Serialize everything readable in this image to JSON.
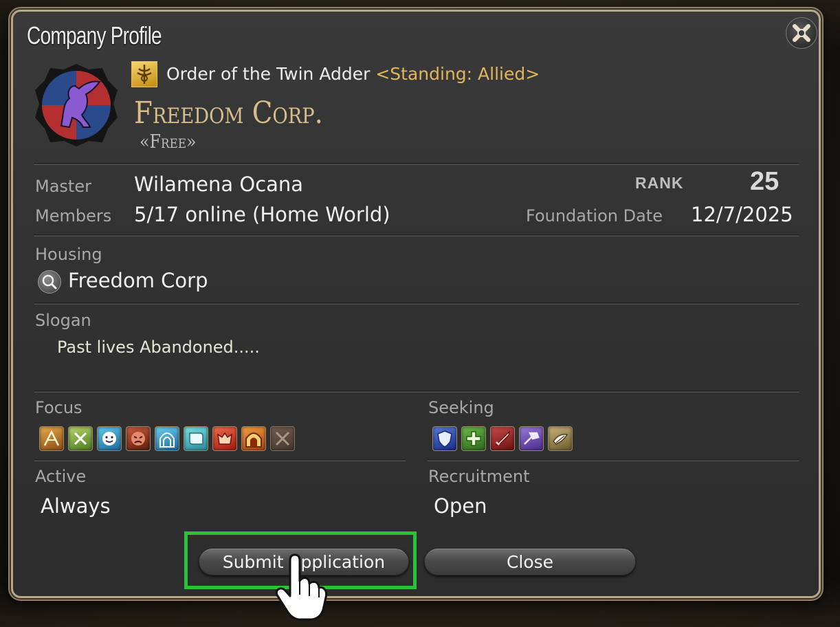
{
  "window": {
    "title": "Company Profile"
  },
  "grand_company": {
    "name": "Order of the Twin Adder",
    "standing": "<Standing: Allied>"
  },
  "company": {
    "name": "Freedom Corp.",
    "tag": "«Free»"
  },
  "details": {
    "master_label": "Master",
    "master_value": "Wilamena Ocana",
    "members_label": "Members",
    "members_value": "5/17 online (Home World)",
    "rank_label": "RANK",
    "rank_value": "25",
    "foundation_label": "Foundation Date",
    "foundation_value": "12/7/2025"
  },
  "housing": {
    "label": "Housing",
    "value": "Freedom Corp"
  },
  "slogan": {
    "label": "Slogan",
    "value": "Past lives Abandoned....."
  },
  "focus": {
    "label": "Focus",
    "icons": [
      "role-playing-icon",
      "leveling-icon",
      "casual-icon",
      "hardcore-icon",
      "dungeons-icon",
      "guildhests-icon",
      "trials-icon",
      "raids-icon",
      "pvp-icon"
    ]
  },
  "seeking": {
    "label": "Seeking",
    "icons": [
      "tank-icon",
      "healer-icon",
      "dps-icon",
      "crafter-icon",
      "gatherer-icon"
    ]
  },
  "active": {
    "label": "Active",
    "value": "Always"
  },
  "recruitment": {
    "label": "Recruitment",
    "value": "Open"
  },
  "buttons": {
    "submit": "Submit Application",
    "close": "Close"
  },
  "colors": {
    "highlight": "#27c33a",
    "company_name": "#d6bd8a",
    "standing": "#e2b65a"
  }
}
